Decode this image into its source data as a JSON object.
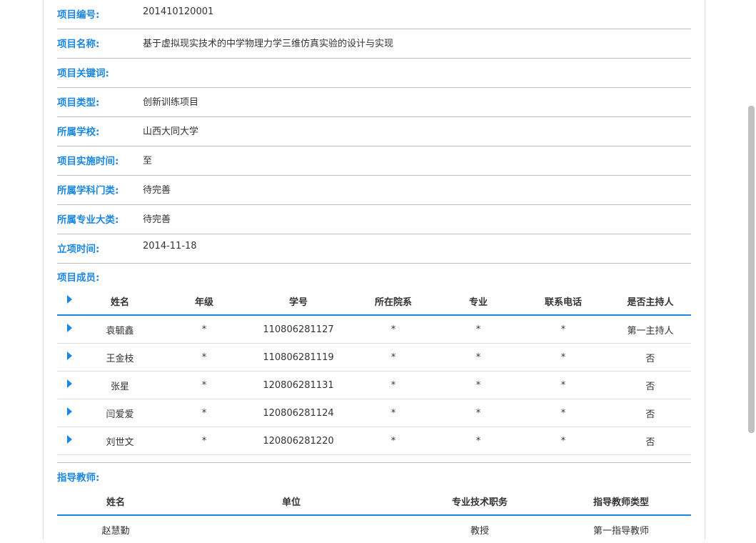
{
  "info": [
    {
      "label": "项目编号:",
      "value": "201410120001"
    },
    {
      "label": "项目名称:",
      "value": "基于虚拟现实技术的中学物理力学三维仿真实验的设计与实现"
    },
    {
      "label": "项目关键词:",
      "value": ""
    },
    {
      "label": "项目类型:",
      "value": "创新训练项目"
    },
    {
      "label": "所属学校:",
      "value": "山西大同大学"
    },
    {
      "label": "项目实施时间:",
      "value": "至"
    },
    {
      "label": "所属学科门类:",
      "value": "待完善"
    },
    {
      "label": "所属专业大类:",
      "value": "待完善"
    },
    {
      "label": "立项时间:",
      "value": "2014-11-18"
    }
  ],
  "members": {
    "label": "项目成员:",
    "headers": [
      "姓名",
      "年级",
      "学号",
      "所在院系",
      "专业",
      "联系电话",
      "是否主持人"
    ],
    "rows": [
      [
        "袁毓鑫",
        "*",
        "110806281127",
        "*",
        "*",
        "*",
        "第一主持人"
      ],
      [
        "王金枝",
        "*",
        "110806281119",
        "*",
        "*",
        "*",
        "否"
      ],
      [
        "张星",
        "*",
        "120806281131",
        "*",
        "*",
        "*",
        "否"
      ],
      [
        "闫爱爱",
        "*",
        "120806281124",
        "*",
        "*",
        "*",
        "否"
      ],
      [
        "刘世文",
        "*",
        "120806281220",
        "*",
        "*",
        "*",
        "否"
      ]
    ]
  },
  "teachers": {
    "label": "指导教师:",
    "headers": [
      "姓名",
      "单位",
      "专业技术职务",
      "指导教师类型"
    ],
    "rows": [
      [
        "赵慧勤",
        "",
        "教授",
        "第一指导教师"
      ]
    ]
  }
}
